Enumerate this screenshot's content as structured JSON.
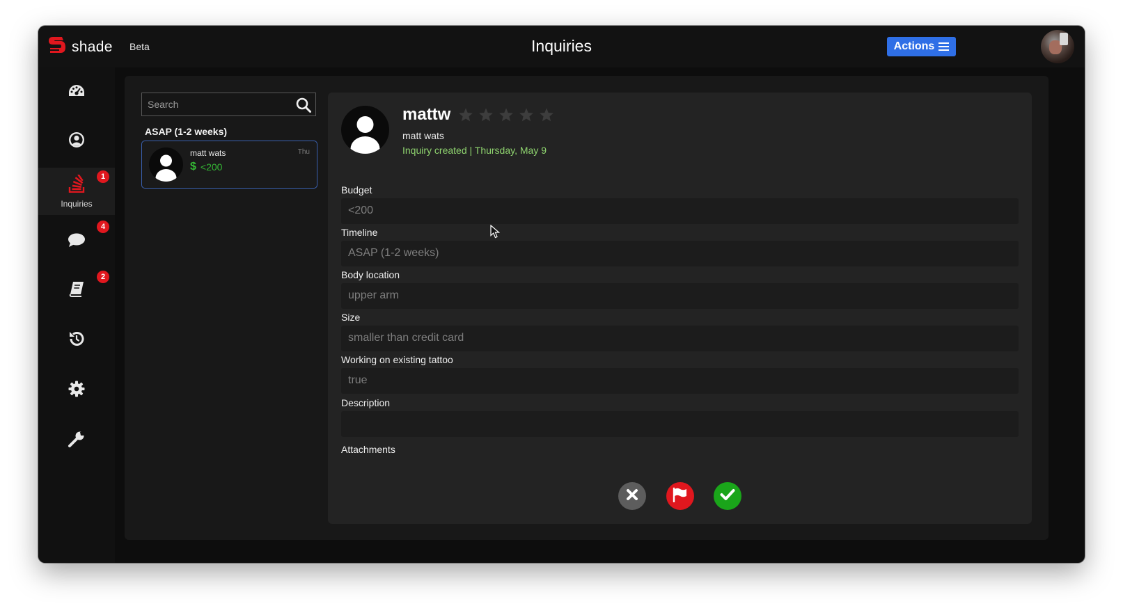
{
  "app": {
    "brand": "shade",
    "tag": "Beta",
    "page_title": "Inquiries",
    "actions_label": "Actions",
    "colors": {
      "accent": "#2f6fe6",
      "brand_red": "#e0171e",
      "success": "#1aa51a",
      "budget_green": "#35b835",
      "created_green": "#8fd46f"
    }
  },
  "sidebar": {
    "items": [
      {
        "icon": "dashboard-icon",
        "label": "",
        "badge": ""
      },
      {
        "icon": "profile-icon",
        "label": "",
        "badge": ""
      },
      {
        "icon": "inquiries-icon",
        "label": "Inquiries",
        "badge": "1",
        "active": true
      },
      {
        "icon": "chat-icon",
        "label": "",
        "badge": "4"
      },
      {
        "icon": "book-icon",
        "label": "",
        "badge": "2"
      },
      {
        "icon": "history-icon",
        "label": "",
        "badge": ""
      },
      {
        "icon": "gear-icon",
        "label": "",
        "badge": ""
      },
      {
        "icon": "wrench-icon",
        "label": "",
        "badge": ""
      }
    ]
  },
  "list": {
    "search_placeholder": "Search",
    "group": "ASAP (1-2 weeks)",
    "items": [
      {
        "name": "matt wats",
        "date": "Thu",
        "budget": "<200",
        "currency_symbol": "$"
      }
    ]
  },
  "detail": {
    "username": "mattw",
    "rating": 0,
    "rating_max": 5,
    "full_name": "matt wats",
    "created": "Inquiry created | Thursday, May 9",
    "fields": [
      {
        "label": "Budget",
        "value": "<200"
      },
      {
        "label": "Timeline",
        "value": "ASAP (1-2 weeks)"
      },
      {
        "label": "Body location",
        "value": "upper arm"
      },
      {
        "label": "Size",
        "value": "smaller than credit card"
      },
      {
        "label": "Working on existing tattoo",
        "value": "true"
      },
      {
        "label": "Description",
        "value": ""
      }
    ],
    "attachments_label": "Attachments",
    "buttons": [
      {
        "icon": "close-icon",
        "color": "#5d5d5d"
      },
      {
        "icon": "flag-icon",
        "color": "#e0171e"
      },
      {
        "icon": "check-icon",
        "color": "#1aa51a"
      }
    ]
  }
}
